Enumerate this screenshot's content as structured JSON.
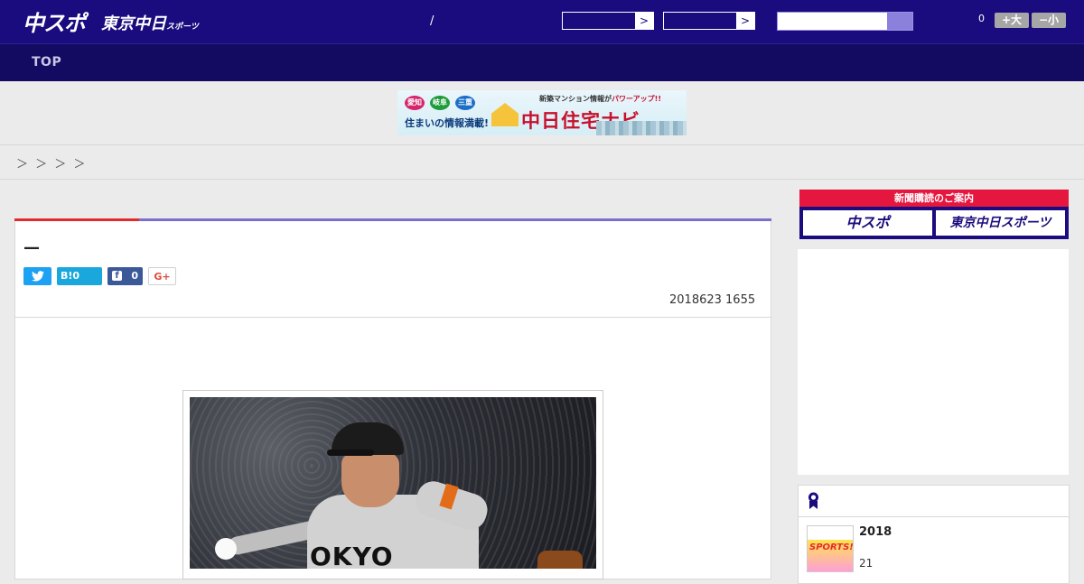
{
  "header": {
    "logo_chunichi": "中スポ",
    "logo_tokyo": "東京中日",
    "logo_tokyo_small": "スポーツ",
    "slash": "/",
    "select_arrow": ">",
    "font_count": "0",
    "font_large_label": "+大",
    "font_small_label": "−小"
  },
  "nav": {
    "top_label": "TOP"
  },
  "banner": {
    "circle1": "愛知",
    "circle2": "岐阜",
    "circle3": "三重",
    "circle_colors": [
      "#d6266b",
      "#1e9b3a",
      "#1c6fc7"
    ],
    "subline": "住まいの情報満載!",
    "tagline": "新築マンション情報が",
    "tagline_accent": "パワーアップ!!",
    "title": "中日住宅ナビ"
  },
  "breadcrumb": {
    "text": "＞ ＞ ＞ ＞"
  },
  "article": {
    "headline": "—",
    "hatena_label": "B!0",
    "facebook_icon": "f",
    "facebook_count": "0",
    "gplus_label": "G+",
    "date": "2018623 1655",
    "photo_jersey_text": "OKYO"
  },
  "sidebar": {
    "subscribe_header": "新聞購読のご案内",
    "subscribe_chunichi": "中スポ",
    "subscribe_tokyo": "東京中日スポーツ",
    "rank_thumb_text": "SPORTS!!",
    "rank_title": "2018",
    "rank_num": "21"
  },
  "colors": {
    "brand_navy": "#1a0c7e",
    "accent_red": "#e52a2f",
    "accent_purple": "#7a6fce"
  }
}
